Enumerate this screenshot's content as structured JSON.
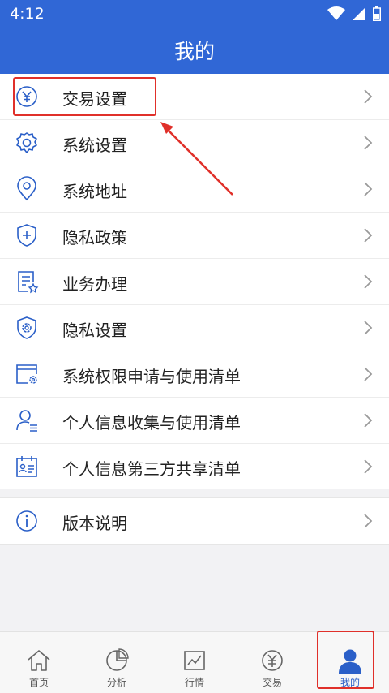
{
  "status_bar": {
    "time": "4:12"
  },
  "header": {
    "title": "我的"
  },
  "menu_group_1": [
    {
      "label": "交易设置",
      "icon": "yen-circle-icon"
    },
    {
      "label": "系统设置",
      "icon": "gear-icon"
    },
    {
      "label": "系统地址",
      "icon": "location-pin-icon"
    },
    {
      "label": "隐私政策",
      "icon": "shield-plus-icon"
    },
    {
      "label": "业务办理",
      "icon": "document-star-icon"
    },
    {
      "label": "隐私设置",
      "icon": "shield-gear-icon"
    },
    {
      "label": "系统权限申请与使用清单",
      "icon": "window-gear-icon"
    },
    {
      "label": "个人信息收集与使用清单",
      "icon": "user-list-icon"
    },
    {
      "label": "个人信息第三方共享清单",
      "icon": "calendar-card-icon"
    }
  ],
  "menu_group_2": [
    {
      "label": "版本说明",
      "icon": "info-circle-icon"
    }
  ],
  "tabbar": [
    {
      "label": "首页",
      "icon": "home-icon"
    },
    {
      "label": "分析",
      "icon": "pie-chart-icon"
    },
    {
      "label": "行情",
      "icon": "line-chart-icon"
    },
    {
      "label": "交易",
      "icon": "yen-circle-icon"
    },
    {
      "label": "我的",
      "icon": "person-icon",
      "active": true
    }
  ],
  "colors": {
    "header_bg": "#3067d6",
    "accent": "#2a5fc8",
    "annotation": "#e0302a"
  }
}
